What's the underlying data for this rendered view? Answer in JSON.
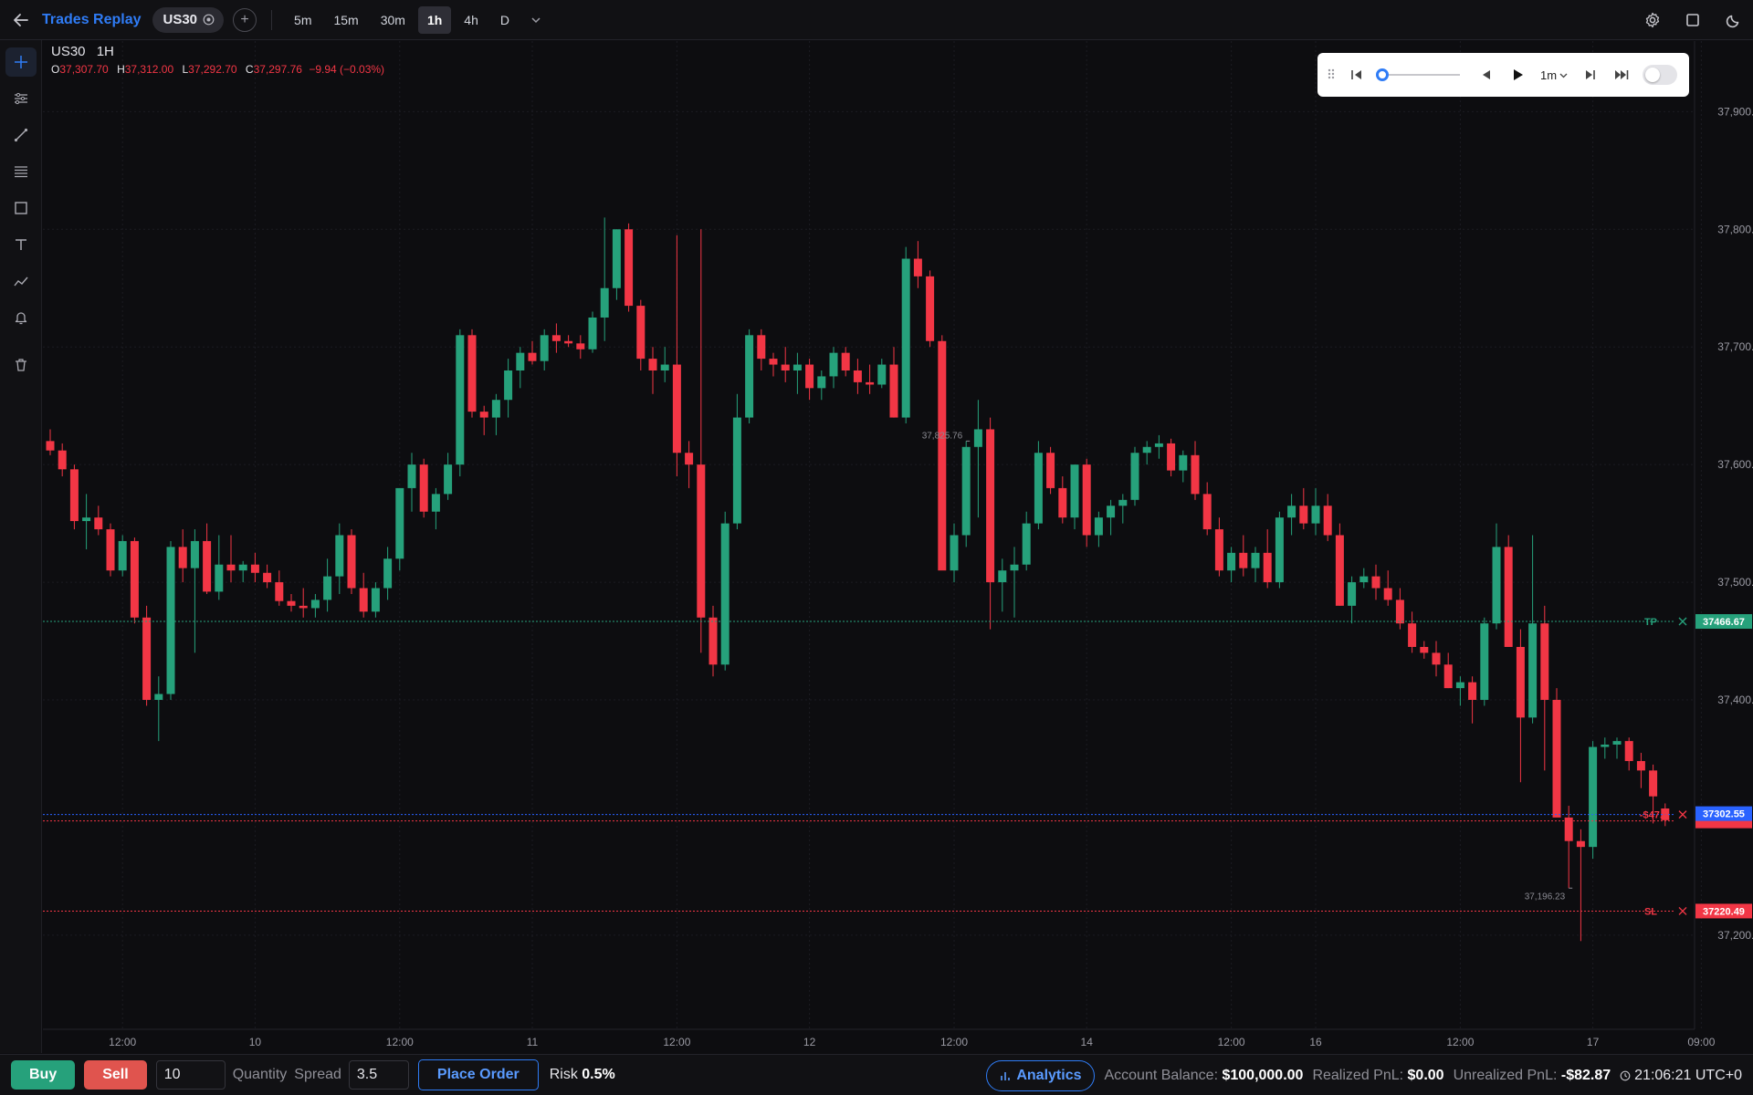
{
  "header": {
    "brand": "Trades Replay",
    "symbol": "US30",
    "timeframes": [
      "5m",
      "15m",
      "30m",
      "1h",
      "4h",
      "D"
    ],
    "active_timeframe": "1h"
  },
  "legend": {
    "symbol": "US30",
    "interval": "1H",
    "o_label": "O",
    "o": "37,307.70",
    "h_label": "H",
    "h": "37,312.00",
    "l_label": "L",
    "l": "37,292.70",
    "c_label": "C",
    "c": "37,297.76",
    "change": "−9.94 (−0.03%)"
  },
  "replay": {
    "speed": "1m",
    "progress": 0.02
  },
  "chart_data": {
    "type": "candlestick",
    "ylim": [
      37120,
      37960
    ],
    "y_ticks": [
      {
        "v": 37900,
        "label": "37,900.00"
      },
      {
        "v": 37800,
        "label": "37,800.00"
      },
      {
        "v": 37700,
        "label": "37,700.00"
      },
      {
        "v": 37600,
        "label": "37,600.00"
      },
      {
        "v": 37500,
        "label": "37,500.00"
      },
      {
        "v": 37400,
        "label": "37,400.00"
      },
      {
        "v": 37200,
        "label": "37,200.00"
      }
    ],
    "x_ticks": [
      {
        "i": 6,
        "label": "12:00"
      },
      {
        "i": 17,
        "label": "10"
      },
      {
        "i": 29,
        "label": "12:00"
      },
      {
        "i": 40,
        "label": "11"
      },
      {
        "i": 52,
        "label": "12:00"
      },
      {
        "i": 63,
        "label": "12"
      },
      {
        "i": 75,
        "label": "12:00"
      },
      {
        "i": 86,
        "label": "14"
      },
      {
        "i": 98,
        "label": "12:00"
      },
      {
        "i": 105,
        "label": "16"
      },
      {
        "i": 117,
        "label": "12:00"
      },
      {
        "i": 128,
        "label": "17"
      },
      {
        "i": 137,
        "label": "09:00"
      }
    ],
    "candles": [
      [
        37620,
        37630,
        37608,
        37612
      ],
      [
        37612,
        37618,
        37590,
        37596
      ],
      [
        37596,
        37600,
        37545,
        37552
      ],
      [
        37552,
        37575,
        37528,
        37555
      ],
      [
        37555,
        37565,
        37540,
        37545
      ],
      [
        37545,
        37550,
        37505,
        37510
      ],
      [
        37510,
        37540,
        37505,
        37535
      ],
      [
        37535,
        37538,
        37465,
        37470
      ],
      [
        37470,
        37480,
        37395,
        37400
      ],
      [
        37400,
        37420,
        37365,
        37405
      ],
      [
        37405,
        37535,
        37400,
        37530
      ],
      [
        37530,
        37545,
        37500,
        37512
      ],
      [
        37512,
        37545,
        37440,
        37535
      ],
      [
        37535,
        37550,
        37490,
        37492
      ],
      [
        37492,
        37540,
        37485,
        37515
      ],
      [
        37515,
        37540,
        37500,
        37510
      ],
      [
        37510,
        37518,
        37500,
        37515
      ],
      [
        37515,
        37525,
        37500,
        37508
      ],
      [
        37508,
        37515,
        37495,
        37500
      ],
      [
        37500,
        37510,
        37480,
        37484
      ],
      [
        37484,
        37490,
        37475,
        37480
      ],
      [
        37480,
        37495,
        37470,
        37478
      ],
      [
        37478,
        37490,
        37470,
        37485
      ],
      [
        37485,
        37520,
        37475,
        37505
      ],
      [
        37505,
        37550,
        37490,
        37540
      ],
      [
        37540,
        37545,
        37490,
        37495
      ],
      [
        37495,
        37508,
        37470,
        37475
      ],
      [
        37475,
        37500,
        37470,
        37495
      ],
      [
        37495,
        37530,
        37485,
        37520
      ],
      [
        37520,
        37580,
        37510,
        37580
      ],
      [
        37580,
        37610,
        37560,
        37600
      ],
      [
        37600,
        37605,
        37555,
        37560
      ],
      [
        37560,
        37580,
        37545,
        37575
      ],
      [
        37575,
        37610,
        37570,
        37600
      ],
      [
        37600,
        37715,
        37590,
        37710
      ],
      [
        37710,
        37715,
        37640,
        37645
      ],
      [
        37645,
        37650,
        37625,
        37640
      ],
      [
        37640,
        37660,
        37625,
        37655
      ],
      [
        37655,
        37690,
        37640,
        37680
      ],
      [
        37680,
        37700,
        37665,
        37695
      ],
      [
        37695,
        37705,
        37685,
        37688
      ],
      [
        37688,
        37715,
        37680,
        37710
      ],
      [
        37710,
        37720,
        37695,
        37705
      ],
      [
        37705,
        37710,
        37700,
        37703
      ],
      [
        37703,
        37710,
        37690,
        37698
      ],
      [
        37698,
        37730,
        37695,
        37725
      ],
      [
        37725,
        37810,
        37705,
        37750
      ],
      [
        37750,
        37800,
        37740,
        37800
      ],
      [
        37800,
        37805,
        37730,
        37735
      ],
      [
        37735,
        37740,
        37680,
        37690
      ],
      [
        37690,
        37700,
        37660,
        37680
      ],
      [
        37680,
        37700,
        37670,
        37685
      ],
      [
        37685,
        37795,
        37590,
        37610
      ],
      [
        37610,
        37620,
        37580,
        37600
      ],
      [
        37600,
        37800,
        37440,
        37470
      ],
      [
        37470,
        37480,
        37420,
        37430
      ],
      [
        37430,
        37560,
        37425,
        37550
      ],
      [
        37550,
        37660,
        37545,
        37640
      ],
      [
        37640,
        37715,
        37635,
        37710
      ],
      [
        37710,
        37715,
        37680,
        37690
      ],
      [
        37690,
        37695,
        37675,
        37685
      ],
      [
        37685,
        37700,
        37670,
        37680
      ],
      [
        37680,
        37695,
        37660,
        37685
      ],
      [
        37685,
        37690,
        37655,
        37665
      ],
      [
        37665,
        37680,
        37655,
        37675
      ],
      [
        37675,
        37700,
        37665,
        37695
      ],
      [
        37695,
        37700,
        37675,
        37680
      ],
      [
        37680,
        37690,
        37660,
        37670
      ],
      [
        37670,
        37685,
        37660,
        37668
      ],
      [
        37668,
        37690,
        37665,
        37685
      ],
      [
        37685,
        37700,
        37640,
        37640
      ],
      [
        37640,
        37785,
        37635,
        37775
      ],
      [
        37775,
        37790,
        37750,
        37760
      ],
      [
        37760,
        37765,
        37700,
        37705
      ],
      [
        37705,
        37710,
        37550,
        37510
      ],
      [
        37510,
        37550,
        37500,
        37540
      ],
      [
        37540,
        37620,
        37530,
        37615
      ],
      [
        37615,
        37655,
        37555,
        37630
      ],
      [
        37630,
        37640,
        37460,
        37500
      ],
      [
        37500,
        37520,
        37475,
        37510
      ],
      [
        37510,
        37530,
        37470,
        37515
      ],
      [
        37515,
        37560,
        37510,
        37550
      ],
      [
        37550,
        37620,
        37545,
        37610
      ],
      [
        37610,
        37615,
        37575,
        37580
      ],
      [
        37580,
        37590,
        37550,
        37555
      ],
      [
        37555,
        37600,
        37545,
        37600
      ],
      [
        37600,
        37605,
        37530,
        37540
      ],
      [
        37540,
        37560,
        37530,
        37555
      ],
      [
        37555,
        37570,
        37540,
        37565
      ],
      [
        37565,
        37575,
        37550,
        37570
      ],
      [
        37570,
        37615,
        37565,
        37610
      ],
      [
        37610,
        37620,
        37600,
        37615
      ],
      [
        37615,
        37625,
        37605,
        37618
      ],
      [
        37618,
        37622,
        37590,
        37595
      ],
      [
        37595,
        37612,
        37585,
        37608
      ],
      [
        37608,
        37620,
        37570,
        37575
      ],
      [
        37575,
        37585,
        37540,
        37545
      ],
      [
        37545,
        37555,
        37505,
        37510
      ],
      [
        37510,
        37530,
        37500,
        37525
      ],
      [
        37525,
        37540,
        37505,
        37512
      ],
      [
        37512,
        37530,
        37500,
        37525
      ],
      [
        37525,
        37545,
        37495,
        37500
      ],
      [
        37500,
        37560,
        37495,
        37555
      ],
      [
        37555,
        37575,
        37540,
        37565
      ],
      [
        37565,
        37580,
        37545,
        37550
      ],
      [
        37550,
        37580,
        37540,
        37565
      ],
      [
        37565,
        37575,
        37535,
        37540
      ],
      [
        37540,
        37550,
        37480,
        37480
      ],
      [
        37480,
        37505,
        37465,
        37500
      ],
      [
        37500,
        37512,
        37495,
        37505
      ],
      [
        37505,
        37515,
        37485,
        37495
      ],
      [
        37495,
        37510,
        37480,
        37485
      ],
      [
        37485,
        37495,
        37460,
        37465
      ],
      [
        37465,
        37475,
        37440,
        37445
      ],
      [
        37445,
        37450,
        37435,
        37440
      ],
      [
        37440,
        37450,
        37420,
        37430
      ],
      [
        37430,
        37440,
        37410,
        37410
      ],
      [
        37410,
        37420,
        37395,
        37415
      ],
      [
        37415,
        37420,
        37380,
        37400
      ],
      [
        37400,
        37470,
        37395,
        37465
      ],
      [
        37465,
        37550,
        37460,
        37530
      ],
      [
        37530,
        37540,
        37445,
        37445
      ],
      [
        37445,
        37460,
        37330,
        37385
      ],
      [
        37385,
        37540,
        37380,
        37465
      ],
      [
        37465,
        37480,
        37340,
        37400
      ],
      [
        37400,
        37410,
        37310,
        37300
      ],
      [
        37300,
        37310,
        37240,
        37280
      ],
      [
        37280,
        37290,
        37195,
        37275
      ],
      [
        37275,
        37365,
        37265,
        37360
      ],
      [
        37360,
        37368,
        37350,
        37362
      ],
      [
        37362,
        37368,
        37350,
        37365
      ],
      [
        37365,
        37368,
        37340,
        37348
      ],
      [
        37348,
        37355,
        37325,
        37340
      ],
      [
        37340,
        37345,
        37295,
        37318
      ],
      [
        37307.7,
        37312,
        37292.7,
        37297.76
      ]
    ],
    "high_marker": {
      "i": 76,
      "label": "37,825.76"
    },
    "low_marker": {
      "i": 126,
      "label": "37,196.23"
    },
    "tp": {
      "label": "TP",
      "price": 37466.67,
      "price_label": "37466.67",
      "color": "#26a17b"
    },
    "sl": {
      "label": "SL",
      "price": 37220.49,
      "price_label": "37220.49",
      "color": "#f23645"
    },
    "entry": {
      "pnl_label": "-$47.9",
      "price": 37302.55,
      "price_label": "37302.55",
      "color": "#f23645",
      "current_color": "#2962ff"
    },
    "colors": {
      "up": "#26a17b",
      "down": "#f23645",
      "grid": "#1c1c22",
      "axis_text": "#9a9aa3"
    }
  },
  "bottom": {
    "buy_label": "Buy",
    "sell_label": "Sell",
    "quantity_value": "10",
    "quantity_label": "Quantity",
    "spread_label": "Spread",
    "spread_value": "3.5",
    "place_label": "Place Order",
    "risk_label": "Risk",
    "risk_value": "0.5%",
    "analytics_label": "Analytics",
    "balance_label": "Account Balance:",
    "balance_value": "$100,000.00",
    "realized_label": "Realized PnL:",
    "realized_value": "$0.00",
    "unrealized_label": "Unrealized PnL:",
    "unrealized_value": "-$82.87",
    "clock": "21:06:21 UTC+0"
  }
}
